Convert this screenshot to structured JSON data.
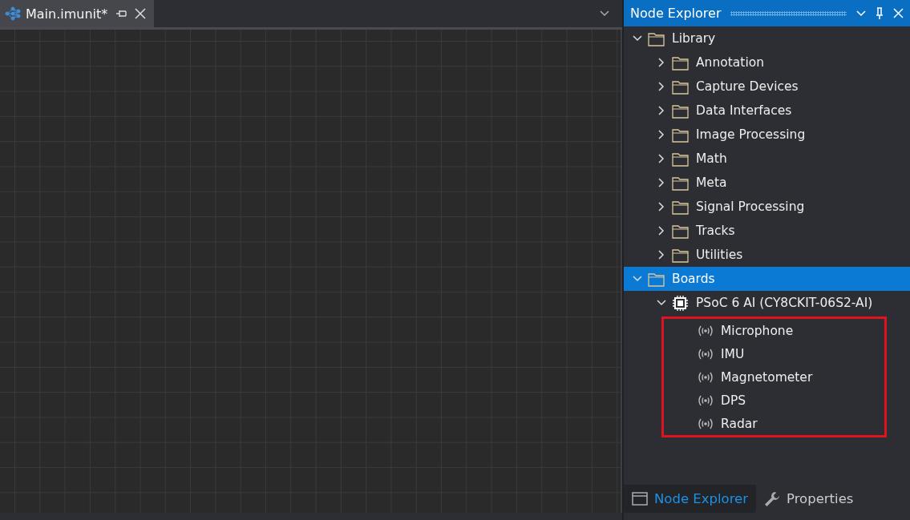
{
  "editor": {
    "tabs": [
      {
        "title": "Main.imunit*",
        "selected": true
      }
    ]
  },
  "explorer": {
    "title": "Node Explorer",
    "tree": [
      {
        "kind": "folder",
        "label": "Library",
        "expanded": true,
        "selected": false,
        "children": [
          {
            "kind": "folder",
            "label": "Annotation",
            "expanded": false,
            "selected": false
          },
          {
            "kind": "folder",
            "label": "Capture Devices",
            "expanded": false,
            "selected": false
          },
          {
            "kind": "folder",
            "label": "Data Interfaces",
            "expanded": false,
            "selected": false
          },
          {
            "kind": "folder",
            "label": "Image Processing",
            "expanded": false,
            "selected": false
          },
          {
            "kind": "folder",
            "label": "Math",
            "expanded": false,
            "selected": false
          },
          {
            "kind": "folder",
            "label": "Meta",
            "expanded": false,
            "selected": false
          },
          {
            "kind": "folder",
            "label": "Signal Processing",
            "expanded": false,
            "selected": false
          },
          {
            "kind": "folder",
            "label": "Tracks",
            "expanded": false,
            "selected": false
          },
          {
            "kind": "folder",
            "label": "Utilities",
            "expanded": false,
            "selected": false
          }
        ]
      },
      {
        "kind": "folder",
        "label": "Boards",
        "expanded": true,
        "selected": true,
        "children": [
          {
            "kind": "board",
            "label": "PSoC 6 AI (CY8CKIT-06S2-AI)",
            "expanded": true,
            "selected": false,
            "highlighted_children": true,
            "children": [
              {
                "kind": "sensor",
                "label": "Microphone",
                "selected": false
              },
              {
                "kind": "sensor",
                "label": "IMU",
                "selected": false
              },
              {
                "kind": "sensor",
                "label": "Magnetometer",
                "selected": false
              },
              {
                "kind": "sensor",
                "label": "DPS",
                "selected": false
              },
              {
                "kind": "sensor",
                "label": "Radar",
                "selected": false
              }
            ]
          }
        ]
      }
    ]
  },
  "bottom_tabs": [
    {
      "kind": "explorer",
      "label": "Node Explorer",
      "selected": true
    },
    {
      "kind": "properties",
      "label": "Properties",
      "selected": false
    }
  ]
}
